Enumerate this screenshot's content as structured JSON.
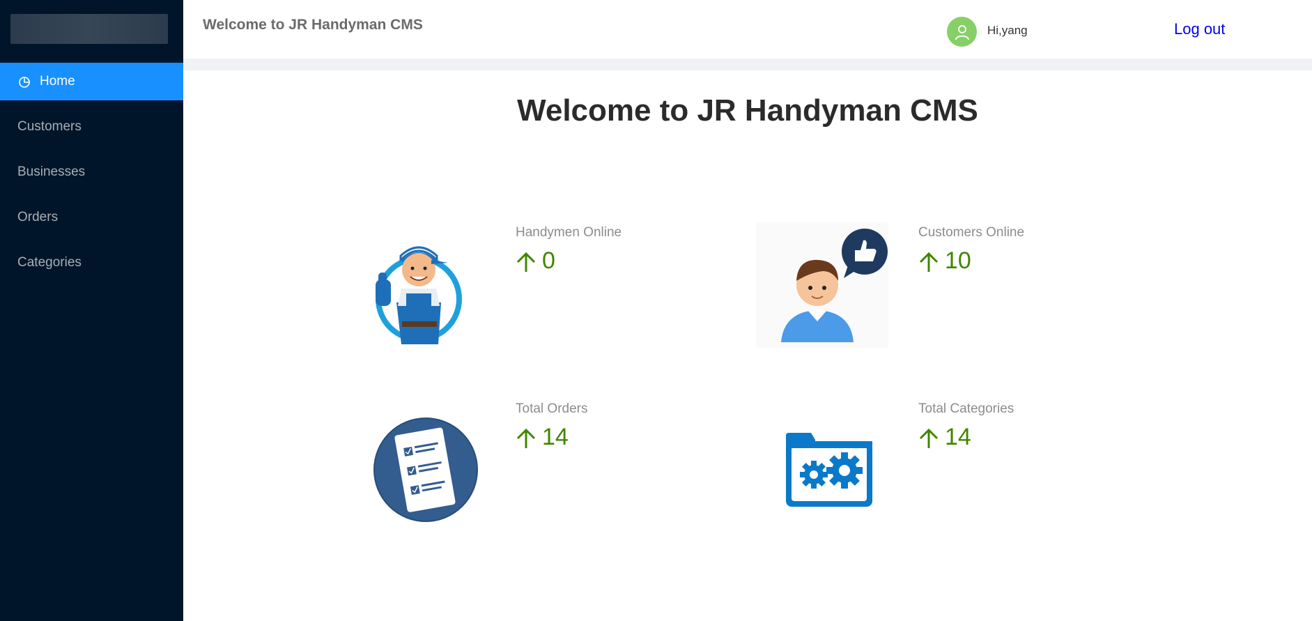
{
  "sidebar": {
    "items": [
      {
        "label": "Home",
        "icon": "pie-chart-icon",
        "active": true
      },
      {
        "label": "Customers"
      },
      {
        "label": "Businesses"
      },
      {
        "label": "Orders"
      },
      {
        "label": "Categories"
      }
    ]
  },
  "header": {
    "title": "Welcome to JR Handyman CMS",
    "greeting": "Hi,yang",
    "logout_label": "Log out"
  },
  "main": {
    "title": "Welcome to JR Handyman CMS",
    "stats": [
      {
        "label": "Handymen Online",
        "value": "0",
        "icon": "handyman-illustration"
      },
      {
        "label": "Customers Online",
        "value": "10",
        "icon": "customer-thumbs-up-illustration"
      },
      {
        "label": "Total Orders",
        "value": "14",
        "icon": "checklist-icon"
      },
      {
        "label": "Total Categories",
        "value": "14",
        "icon": "folder-gear-icon"
      }
    ]
  },
  "colors": {
    "sidebar_bg": "#001529",
    "active_item": "#1890ff",
    "stat_value": "#3f8600",
    "avatar_bg": "#87d068"
  }
}
